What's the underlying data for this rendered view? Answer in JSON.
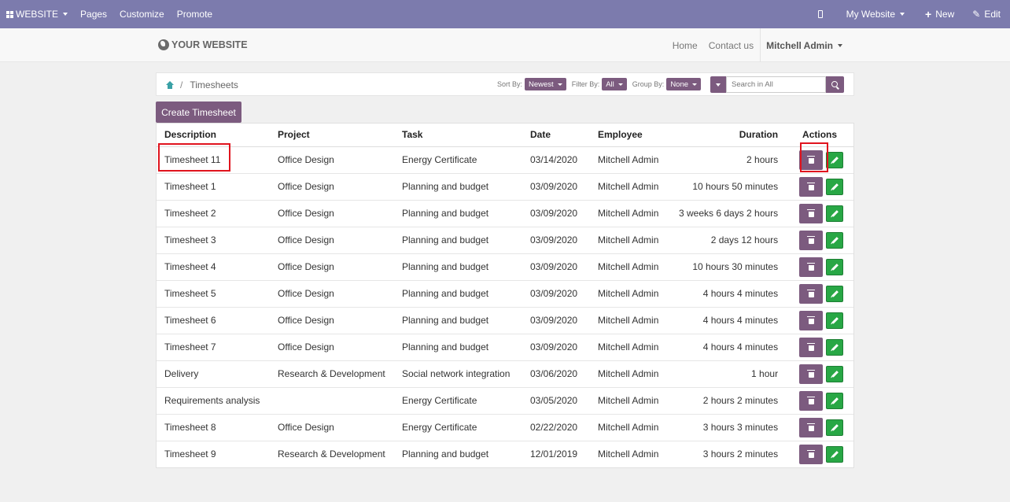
{
  "topbar": {
    "brand_label": "WEBSITE",
    "menu": [
      "Pages",
      "Customize",
      "Promote"
    ],
    "website_selector": "My Website",
    "new_label": "New",
    "edit_label": "Edit",
    "background": "#7c7bad"
  },
  "site_header": {
    "logo_text": "YOUR WEBSITE",
    "nav": [
      "Home",
      "Contact us"
    ],
    "user": "Mitchell Admin"
  },
  "breadcrumb": {
    "home_icon": "home-icon",
    "current": "Timesheets"
  },
  "filters": {
    "sort_label": "Sort By:",
    "sort_value": "Newest",
    "filter_label": "Filter By:",
    "filter_value": "All",
    "group_label": "Group By:",
    "group_value": "None",
    "search_placeholder": "Search in All"
  },
  "create_button": "Create Timesheet",
  "accent_color": "#7c5b7f",
  "edit_color": "#28a745",
  "table": {
    "columns": [
      "Description",
      "Project",
      "Task",
      "Date",
      "Employee",
      "Duration",
      "Actions"
    ],
    "rows": [
      {
        "description": "Timesheet 11",
        "project": "Office Design",
        "task": "Energy Certificate",
        "date": "03/14/2020",
        "employee": "Mitchell Admin",
        "duration": "2 hours"
      },
      {
        "description": "Timesheet 1",
        "project": "Office Design",
        "task": "Planning and budget",
        "date": "03/09/2020",
        "employee": "Mitchell Admin",
        "duration": "10 hours 50 minutes"
      },
      {
        "description": "Timesheet 2",
        "project": "Office Design",
        "task": "Planning and budget",
        "date": "03/09/2020",
        "employee": "Mitchell Admin",
        "duration": "3 weeks 6 days 2 hours"
      },
      {
        "description": "Timesheet 3",
        "project": "Office Design",
        "task": "Planning and budget",
        "date": "03/09/2020",
        "employee": "Mitchell Admin",
        "duration": "2 days 12 hours"
      },
      {
        "description": "Timesheet 4",
        "project": "Office Design",
        "task": "Planning and budget",
        "date": "03/09/2020",
        "employee": "Mitchell Admin",
        "duration": "10 hours 30 minutes"
      },
      {
        "description": "Timesheet 5",
        "project": "Office Design",
        "task": "Planning and budget",
        "date": "03/09/2020",
        "employee": "Mitchell Admin",
        "duration": "4 hours 4 minutes"
      },
      {
        "description": "Timesheet 6",
        "project": "Office Design",
        "task": "Planning and budget",
        "date": "03/09/2020",
        "employee": "Mitchell Admin",
        "duration": "4 hours 4 minutes"
      },
      {
        "description": "Timesheet 7",
        "project": "Office Design",
        "task": "Planning and budget",
        "date": "03/09/2020",
        "employee": "Mitchell Admin",
        "duration": "4 hours 4 minutes"
      },
      {
        "description": "Delivery",
        "project": "Research & Development",
        "task": "Social network integration",
        "date": "03/06/2020",
        "employee": "Mitchell Admin",
        "duration": "1 hour"
      },
      {
        "description": "Requirements analysis",
        "project": "",
        "task": "Energy Certificate",
        "date": "03/05/2020",
        "employee": "Mitchell Admin",
        "duration": "2 hours 2 minutes"
      },
      {
        "description": "Timesheet 8",
        "project": "Office Design",
        "task": "Energy Certificate",
        "date": "02/22/2020",
        "employee": "Mitchell Admin",
        "duration": "3 hours 3 minutes"
      },
      {
        "description": "Timesheet 9",
        "project": "Research & Development",
        "task": "Planning and budget",
        "date": "12/01/2019",
        "employee": "Mitchell Admin",
        "duration": "3 hours 2 minutes"
      }
    ]
  }
}
